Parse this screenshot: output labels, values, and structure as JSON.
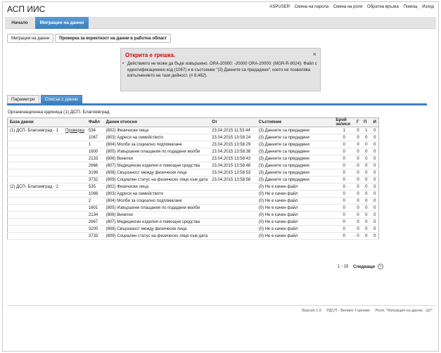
{
  "app_title": "АСП ИИС",
  "top_links": [
    "ASPUSER",
    "Смяна на парола",
    "Смяна на роля",
    "Обратна връзка",
    "Помощ",
    "Изход"
  ],
  "nav": {
    "home": "Начало",
    "migration": "Миграции на данни"
  },
  "breadcrumb": {
    "item1": "Миграция на данни",
    "item2": "Проверка за коректност на данни в работна област"
  },
  "error": {
    "title": "Открита е грешка.",
    "close": "×",
    "bullet": "•",
    "message": "Действието не може да бъде извършено. ORA-20000: -20000 ORA-20000: (MGR-R-8024): Файл с идентификационен код (1067) е в състояние \"(3) Данните са предадени\", което не позволява изпълнението на тази дейност. (# 8,482)."
  },
  "tabs": {
    "params": "Параметри",
    "list": "Списък с данни"
  },
  "org_unit": "Организационна единица (1) ДСП- Благоевград",
  "table": {
    "headers": {
      "base": "База данни",
      "file": "Файл",
      "data": "Данни относно",
      "from": "От",
      "state": "Състояние",
      "count": "Брой записи",
      "g": "Г",
      "p": "П",
      "i": "И"
    },
    "check_label": "Проверка",
    "rows": [
      {
        "base": "(1) ДСП- Благоевград - 1",
        "check": true,
        "file": "534",
        "data": "(802) Физически лица",
        "from": "23.04.2015 11:53:44",
        "state": "(3) Данните са предадени",
        "count": "1",
        "g": "0",
        "p": "1",
        "i": "0"
      },
      {
        "base": "",
        "check": false,
        "file": "1067",
        "data": "(803) Адреси на семейството",
        "from": "23.04.2015 13:58:24",
        "state": "(3) Данните са предадени",
        "count": "0",
        "g": "0",
        "p": "0",
        "i": "0"
      },
      {
        "base": "",
        "check": false,
        "file": "1",
        "data": "(804) Молби за социално подпомагане",
        "from": "23.04.2015 13:58:29",
        "state": "(3) Данните са предадени",
        "count": "0",
        "g": "0",
        "p": "0",
        "i": "0"
      },
      {
        "base": "",
        "check": false,
        "file": "1600",
        "data": "(805) Извършени плащания по подадени молби",
        "from": "23.04.2015 13:58:38",
        "state": "(3) Данните са предадени",
        "count": "0",
        "g": "0",
        "p": "0",
        "i": "0"
      },
      {
        "base": "",
        "check": false,
        "file": "2133",
        "data": "(806) Винетки",
        "from": "23.04.2015 13:58:43",
        "state": "(3) Данните са предадени",
        "count": "0",
        "g": "0",
        "p": "0",
        "i": "0"
      },
      {
        "base": "",
        "check": false,
        "file": "2666",
        "data": "(807) Медицински изделия и помощни средства",
        "from": "23.04.2015 13:58:48",
        "state": "(3) Данните са предадени",
        "count": "0",
        "g": "0",
        "p": "0",
        "i": "0"
      },
      {
        "base": "",
        "check": false,
        "file": "3199",
        "data": "(808) Свързаност между физически лица",
        "from": "23.04.2015 13:58:53",
        "state": "(3) Данните са предадени",
        "count": "0",
        "g": "0",
        "p": "0",
        "i": "0"
      },
      {
        "base": "",
        "check": false,
        "file": "3732",
        "data": "(809) Социален статус на физическо лице към дата",
        "from": "23.04.2015 13:58:58",
        "state": "(3) Данните са предадени",
        "count": "0",
        "g": "0",
        "p": "0",
        "i": "0"
      },
      {
        "base": "(2) ДСП- Благоевград - 2",
        "check": false,
        "file": "535",
        "data": "(802) Физически лица",
        "from": "",
        "state": "(0) Не е качен файл",
        "count": "0",
        "g": "0",
        "p": "0",
        "i": "0"
      },
      {
        "base": "",
        "check": false,
        "file": "1068",
        "data": "(803) Адреси на семейството",
        "from": "",
        "state": "(0) Не е качен файл",
        "count": "0",
        "g": "0",
        "p": "0",
        "i": "0"
      },
      {
        "base": "",
        "check": false,
        "file": "2",
        "data": "(804) Молби за социално подпомагане",
        "from": "",
        "state": "(0) Не е качен файл",
        "count": "0",
        "g": "0",
        "p": "0",
        "i": "0"
      },
      {
        "base": "",
        "check": false,
        "file": "1601",
        "data": "(805) Извършени плащания по подадени молби",
        "from": "",
        "state": "(0) Не е качен файл",
        "count": "0",
        "g": "0",
        "p": "0",
        "i": "0"
      },
      {
        "base": "",
        "check": false,
        "file": "2134",
        "data": "(806) Винетки",
        "from": "",
        "state": "(0) Не е качен файл",
        "count": "0",
        "g": "0",
        "p": "0",
        "i": "0"
      },
      {
        "base": "",
        "check": false,
        "file": "2667",
        "data": "(807) Медицински изделия и помощни средства",
        "from": "",
        "state": "(0) Не е качен файл",
        "count": "0",
        "g": "0",
        "p": "0",
        "i": "0"
      },
      {
        "base": "",
        "check": false,
        "file": "3200",
        "data": "(808) Свързаност между физически лица",
        "from": "",
        "state": "(0) Не е качен файл",
        "count": "0",
        "g": "0",
        "p": "0",
        "i": "0"
      },
      {
        "base": "",
        "check": false,
        "file": "3733",
        "data": "(809) Социален статус на физическо лице към дата",
        "from": "",
        "state": "(0) Не е качен файл",
        "count": "0",
        "g": "0",
        "p": "0",
        "i": "0"
      }
    ]
  },
  "pager": {
    "range": "1 - 16",
    "next": "Следващи",
    "arrow": "›"
  },
  "footer": {
    "version": "Версия 1.0",
    "unit": "РДСП - Велико Търново",
    "role": "Роля: \"Миграция на данни - ЦУ\""
  }
}
